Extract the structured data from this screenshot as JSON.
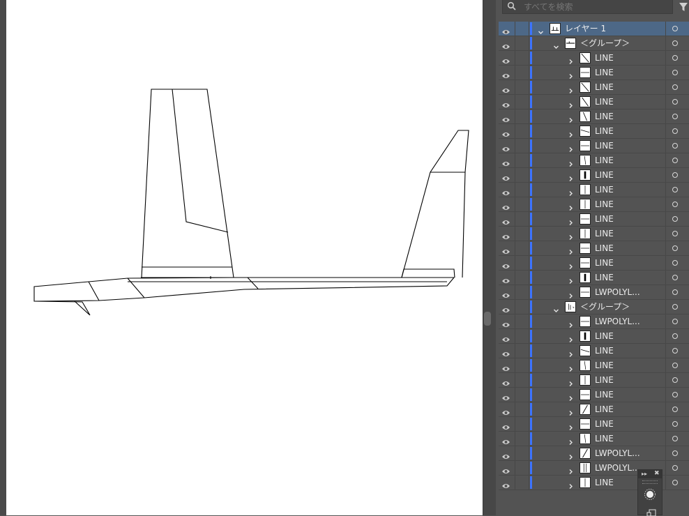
{
  "search": {
    "placeholder": "すべてを検索"
  },
  "layers": [
    {
      "name": "レイヤー 1",
      "depth": 0,
      "expanded": true,
      "selected": true,
      "thumb": "layer"
    },
    {
      "name": "＜グループ＞",
      "depth": 1,
      "expanded": true,
      "thumb": "group1"
    },
    {
      "name": "LINE",
      "depth": 2,
      "thumb": "diag"
    },
    {
      "name": "LINE",
      "depth": 2,
      "thumb": "hline"
    },
    {
      "name": "LINE",
      "depth": 2,
      "thumb": "diag"
    },
    {
      "name": "LINE",
      "depth": 2,
      "thumb": "diag2"
    },
    {
      "name": "LINE",
      "depth": 2,
      "thumb": "diag3"
    },
    {
      "name": "LINE",
      "depth": 2,
      "thumb": "hslant"
    },
    {
      "name": "LINE",
      "depth": 2,
      "thumb": "hline"
    },
    {
      "name": "LINE",
      "depth": 2,
      "thumb": "vslant"
    },
    {
      "name": "LINE",
      "depth": 2,
      "thumb": "vbold"
    },
    {
      "name": "LINE",
      "depth": 2,
      "thumb": "vline"
    },
    {
      "name": "LINE",
      "depth": 2,
      "thumb": "vline"
    },
    {
      "name": "LINE",
      "depth": 2,
      "thumb": "hline"
    },
    {
      "name": "LINE",
      "depth": 2,
      "thumb": "vline"
    },
    {
      "name": "LINE",
      "depth": 2,
      "thumb": "hline"
    },
    {
      "name": "LINE",
      "depth": 2,
      "thumb": "hline"
    },
    {
      "name": "LINE",
      "depth": 2,
      "thumb": "vbold"
    },
    {
      "name": "LWPOLYL...",
      "depth": 2,
      "thumb": "hline"
    },
    {
      "name": "＜グループ＞",
      "depth": 1,
      "expanded": true,
      "thumb": "group2"
    },
    {
      "name": "LWPOLYL...",
      "depth": 2,
      "thumb": "hline"
    },
    {
      "name": "LINE",
      "depth": 2,
      "thumb": "vbold"
    },
    {
      "name": "LINE",
      "depth": 2,
      "thumb": "hslant"
    },
    {
      "name": "LINE",
      "depth": 2,
      "thumb": "vslant"
    },
    {
      "name": "LINE",
      "depth": 2,
      "thumb": "vline"
    },
    {
      "name": "LINE",
      "depth": 2,
      "thumb": "hline"
    },
    {
      "name": "LINE",
      "depth": 2,
      "thumb": "diag4"
    },
    {
      "name": "LINE",
      "depth": 2,
      "thumb": "hline"
    },
    {
      "name": "LINE",
      "depth": 2,
      "thumb": "vslant"
    },
    {
      "name": "LWPOLYL...",
      "depth": 2,
      "thumb": "diag4"
    },
    {
      "name": "LWPOLYL...",
      "depth": 2,
      "thumb": "vline2"
    },
    {
      "name": "LINE",
      "depth": 2,
      "thumb": "vline"
    }
  ],
  "colors": {
    "selection": "#4d6887",
    "layer_color": "#3c73ff",
    "panel_bg": "#535353"
  }
}
